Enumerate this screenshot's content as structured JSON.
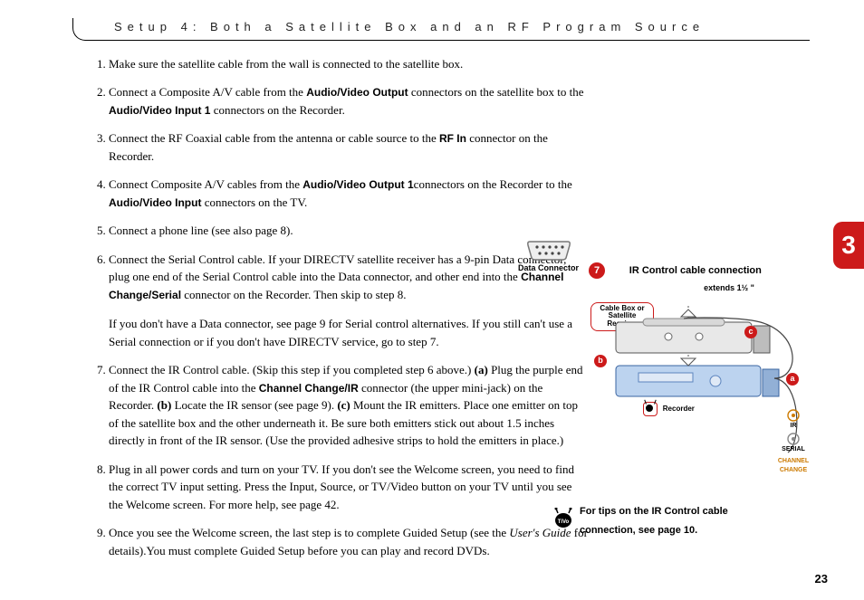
{
  "header": {
    "title": "Setup 4: Both a Satellite Box and an RF Program Source"
  },
  "chapter_tab": "3",
  "page_number": "23",
  "data_connector_label": "Data Connector",
  "diagram": {
    "title": "IR Control cable connection",
    "number": "7",
    "extends_label": "extends 1½ \"",
    "box_label": "Cable Box or Satellite Receiver",
    "recorder_label": "Recorder",
    "jack_ir": "IR",
    "jack_serial": "SERIAL",
    "jack_channel": "CHANNEL CHANGE",
    "marker_a": "a",
    "marker_b": "b",
    "marker_c": "c"
  },
  "tip": {
    "line1": "For tips on the IR Control cable",
    "line2": "connection, see page 10."
  },
  "steps": {
    "s1": "Make sure the satellite cable from the wall is connected to the satellite box.",
    "s2_a": "Connect a Composite A/V cable from the ",
    "s2_b": "Audio/Video Output",
    "s2_c": " connectors on the satellite box to the ",
    "s2_d": "Audio/Video Input 1",
    "s2_e": " connectors on the Recorder.",
    "s3_a": "Connect the RF Coaxial cable from the antenna or cable source to the ",
    "s3_b": "RF In",
    "s3_c": " connector on the Recorder.",
    "s4_a": "Connect Composite A/V cables from the ",
    "s4_b": "Audio/Video Output 1",
    "s4_c": "connectors on the Recorder to the ",
    "s4_d": "Audio/Video Input",
    "s4_e": " connectors on the TV.",
    "s5": "Connect a phone line (see also page 8).",
    "s6_a": "Connect the Serial Control cable. If your DIRECTV satellite receiver has a 9-pin Data connector, plug one end of the Serial Control cable into the Data connector, and other end into the ",
    "s6_b": "Channel Change/Serial",
    "s6_c": " connector on the Recorder. Then skip to step 8.",
    "s6_alt": "If you don't have a Data connector, see page 9 for Serial control alternatives. If you still can't use a Serial connection or if you don't have DIRECTV service, go to step 7.",
    "s7_a": "Connect the IR Control cable. (Skip this step if you completed step 6 above.) ",
    "s7_b": "(a)",
    "s7_c": " Plug the purple end of the IR Control cable into the ",
    "s7_d": "Channel Change/IR",
    "s7_e": " connector (the upper mini-jack) on the Recorder. ",
    "s7_f": "(b)",
    "s7_g": " Locate the IR sensor (see page 9). ",
    "s7_h": "(c)",
    "s7_i": " Mount the IR emitters. Place one emitter on top of the satellite box and the other underneath it. Be sure both emitters stick out about 1.5 inches directly in front of the IR sensor. (Use the provided adhesive strips to hold the emitters in place.)",
    "s8": "Plug in all power cords and turn on your TV. If you don't see the Welcome screen, you need to find the correct TV input setting. Press the Input, Source, or TV/Video button on your TV until you see the Welcome screen. For more help, see page 42.",
    "s9_a": "Once you see the Welcome screen, the last step is to complete Guided Setup (see the ",
    "s9_b": "User's Guide",
    "s9_c": " for details).You must complete Guided Setup before you can play and record DVDs."
  }
}
